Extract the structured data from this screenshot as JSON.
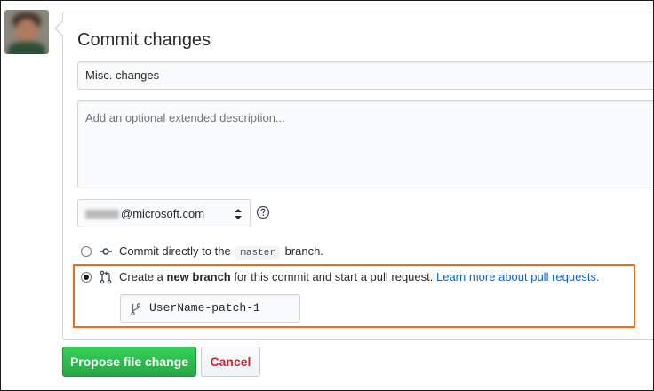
{
  "form": {
    "title": "Commit changes",
    "summary_value": "Misc. changes",
    "description_placeholder": "Add an optional extended description...",
    "email_domain": "@microsoft.com"
  },
  "options": {
    "direct": {
      "prefix": "Commit directly to the",
      "branch": "master",
      "suffix": "branch.",
      "icon": "git-commit-icon"
    },
    "new_branch": {
      "prefix": "Create a",
      "bold": "new branch",
      "middle": "for this commit and start a pull request.",
      "link": "Learn more about pull requests.",
      "icon": "git-pull-request-icon",
      "branch_name": "UserName-patch-1"
    }
  },
  "buttons": {
    "propose": "Propose file change",
    "cancel": "Cancel"
  },
  "colors": {
    "primary": "#28a745",
    "danger": "#cb2431",
    "link": "#0366d6",
    "highlight": "#ee6c15"
  }
}
